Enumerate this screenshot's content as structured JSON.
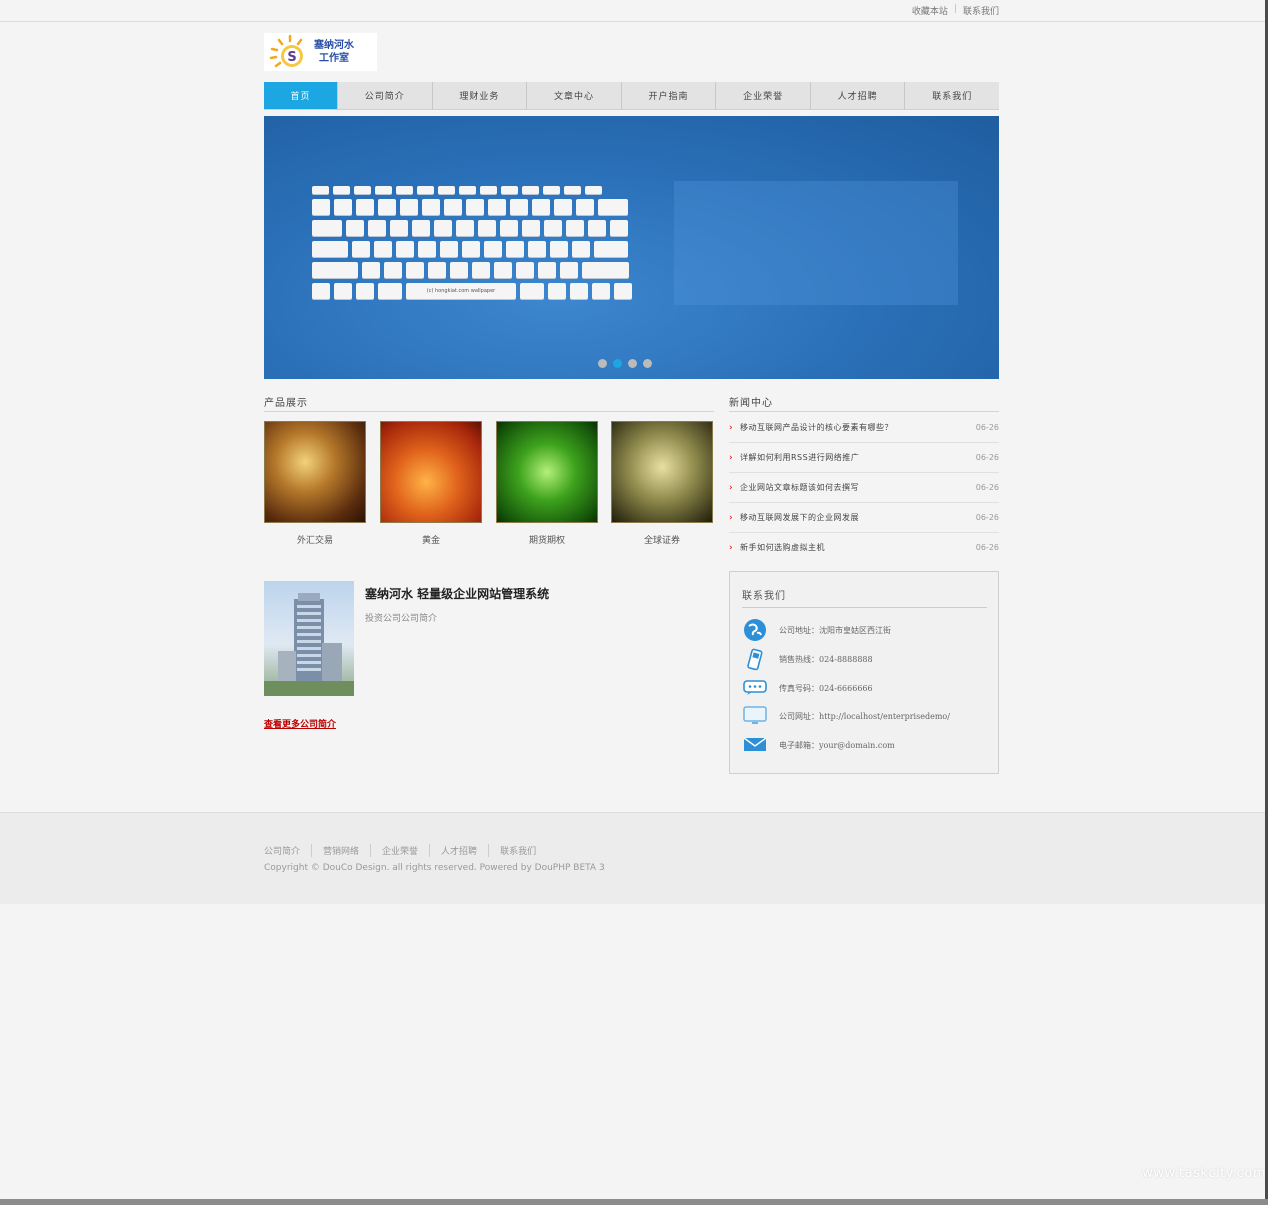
{
  "toplinks": {
    "bookmark": "收藏本站",
    "contact": "联系我们"
  },
  "logo": {
    "line1": "塞纳河水",
    "line2": "工作室"
  },
  "nav": {
    "items": [
      {
        "label": "首页"
      },
      {
        "label": "公司简介"
      },
      {
        "label": "理财业务"
      },
      {
        "label": "文章中心"
      },
      {
        "label": "开户指南"
      },
      {
        "label": "企业荣誉"
      },
      {
        "label": "人才招聘"
      },
      {
        "label": "联系我们"
      }
    ]
  },
  "banner": {
    "wallpaper_label": "(c) hongkiat.com wallpaper",
    "active_slide": 2,
    "slide_count": 4
  },
  "products": {
    "title": "产品展示",
    "items": [
      {
        "name": "外汇交易"
      },
      {
        "name": "黄金"
      },
      {
        "name": "期货期权"
      },
      {
        "name": "全球证券"
      }
    ]
  },
  "about": {
    "title": "塞纳河水  轻量级企业网站管理系统",
    "subtitle": "投资公司公司简介",
    "more": "查看更多公司简介"
  },
  "news": {
    "title": "新闻中心",
    "items": [
      {
        "title": "移动互联网产品设计的核心要素有哪些？",
        "date": "06-26"
      },
      {
        "title": "详解如何利用RSS进行网络推广",
        "date": "06-26"
      },
      {
        "title": "企业网站文章标题该如何去撰写",
        "date": "06-26"
      },
      {
        "title": "移动互联网发展下的企业网发展",
        "date": "06-26"
      },
      {
        "title": "新手如何选购虚拟主机",
        "date": "06-26"
      }
    ]
  },
  "contact": {
    "title": "联系我们",
    "rows": [
      {
        "icon": "globe-icon",
        "text": "公司地址：沈阳市皇姑区西江街"
      },
      {
        "icon": "phone-icon",
        "text": "销售热线：024-8888888"
      },
      {
        "icon": "chat-icon",
        "text": "传真号码：024-6666666"
      },
      {
        "icon": "monitor-icon",
        "text": "公司网址：http://localhost/enterprisedemo/"
      },
      {
        "icon": "mail-icon",
        "text": "电子邮箱：your@domain.com"
      }
    ]
  },
  "footer": {
    "links": [
      "公司简介",
      "营销网络",
      "企业荣誉",
      "人才招聘",
      "联系我们"
    ],
    "copyright": "Copyright © DouCo Design. all rights reserved. Powered by DouPHP BETA 3"
  },
  "watermark": "www.taskcity.com"
}
